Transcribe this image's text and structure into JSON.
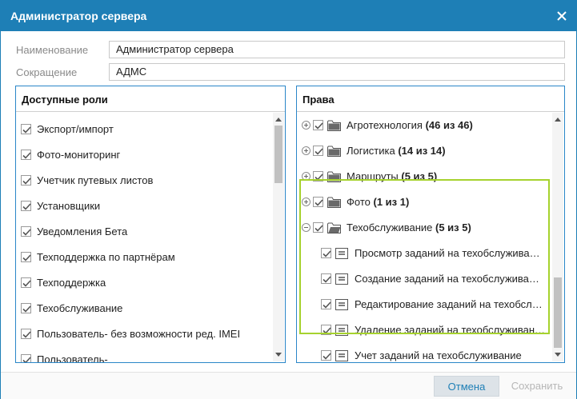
{
  "dialog": {
    "title": "Администратор сервера",
    "close_icon": "close-icon"
  },
  "form": {
    "name_label": "Наименование",
    "name_value": "Администратор сервера",
    "abbr_label": "Сокращение",
    "abbr_value": "АДМС"
  },
  "roles_panel": {
    "title": "Доступные роли",
    "items": [
      {
        "label": "Экспорт/импорт",
        "checked": true
      },
      {
        "label": "Фото-мониторинг",
        "checked": true
      },
      {
        "label": "Учетчик путевых листов",
        "checked": true
      },
      {
        "label": "Установщики",
        "checked": true
      },
      {
        "label": "Уведомления Бета",
        "checked": true
      },
      {
        "label": "Техподдержка по партнёрам",
        "checked": true
      },
      {
        "label": "Техподдержка",
        "checked": true
      },
      {
        "label": "Техобслуживание",
        "checked": true
      },
      {
        "label": "Пользователь- без возможности ред. IMEI",
        "checked": true
      },
      {
        "label": "Пользователь-",
        "checked": true
      }
    ]
  },
  "rights_panel": {
    "title": "Права",
    "groups": [
      {
        "name": "Агротехнология",
        "count": "(46 из 46)",
        "expanded": false
      },
      {
        "name": "Логистика",
        "count": "(14 из 14)",
        "expanded": false
      },
      {
        "name": "Маршруты",
        "count": "(5 из 5)",
        "expanded": false
      },
      {
        "name": "Фото",
        "count": "(1 из 1)",
        "expanded": false
      },
      {
        "name": "Техобслуживание",
        "count": "(5 из 5)",
        "expanded": true
      }
    ],
    "items": [
      {
        "label": "Просмотр заданий на техобслуживание",
        "checked": true
      },
      {
        "label": "Создание заданий на техобслуживание",
        "checked": true
      },
      {
        "label": "Редактирование заданий на техобслуживание",
        "checked": true
      },
      {
        "label": "Удаление заданий на техобслуживание",
        "checked": true
      },
      {
        "label": "Учет заданий на техобслуживание",
        "checked": true
      }
    ]
  },
  "footer": {
    "cancel_label": "Отмена",
    "save_label": "Сохранить"
  },
  "colors": {
    "accent": "#1e7fb6",
    "highlight": "#a6d22e"
  }
}
